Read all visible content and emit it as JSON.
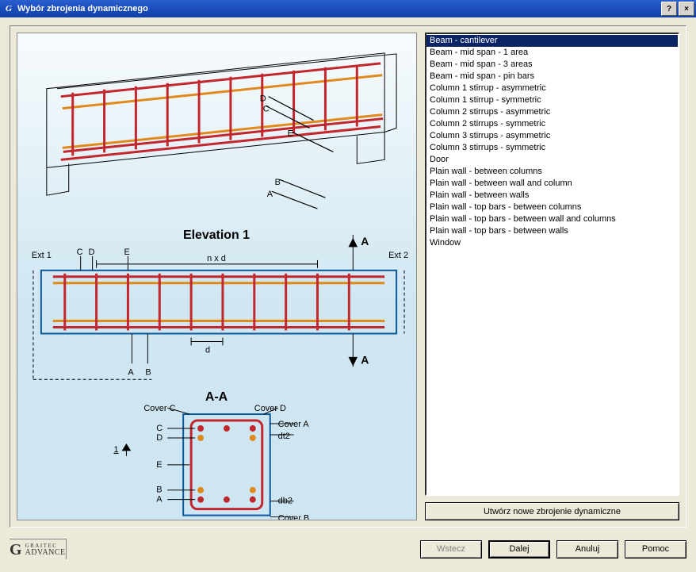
{
  "window": {
    "title": "Wybór zbrojenia dynamicznego",
    "help_btn": "?",
    "close_btn": "×"
  },
  "list": {
    "selected_index": 0,
    "items": [
      "Beam - cantilever",
      "Beam - mid span - 1 area",
      "Beam - mid span - 3 areas",
      "Beam - mid span - pin bars",
      "Column 1 stirrup  - asymmetric",
      "Column 1 stirrup  - symmetric",
      "Column 2 stirrups - asymmetric",
      "Column 2 stirrups - symmetric",
      "Column 3 stirrups - asymmetric",
      "Column 3 stirrups - symmetric",
      "Door",
      "Plain wall - between columns",
      "Plain wall - between wall and column",
      "Plain wall - between walls",
      "Plain wall - top bars - between columns",
      "Plain wall - top bars - between wall and columns",
      "Plain wall - top bars - between walls",
      "Window"
    ]
  },
  "buttons": {
    "new_dynamic": "Utwórz nowe zbrojenie dynamiczne",
    "back": "Wstecz",
    "next": "Dalej",
    "cancel": "Anuluj",
    "help": "Pomoc"
  },
  "logo": {
    "company_small": "GRAITEC",
    "product": "ADVANCE"
  },
  "diagram": {
    "elevation_title": "Elevation 1",
    "section_title": "A-A",
    "ext1": "Ext 1",
    "ext2": "Ext 2",
    "nxd": "n x d",
    "d": "d",
    "one": "1",
    "A": "A",
    "B": "B",
    "C": "C",
    "D": "D",
    "E": "E",
    "coverA": "Cover A",
    "coverB": "Cover B",
    "coverC": "Cover C",
    "coverD": "Cover D",
    "dt2": "dt2",
    "db2": "db2"
  }
}
